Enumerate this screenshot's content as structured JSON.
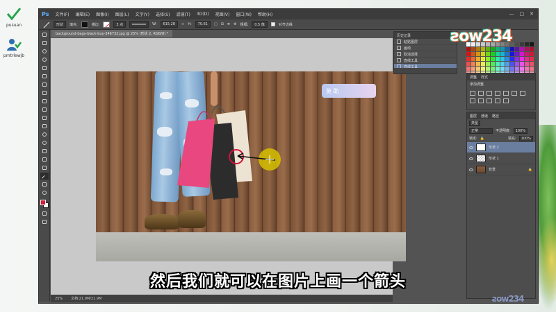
{
  "desktop": {
    "icons": [
      {
        "label": "pusuan",
        "icon": "check-icon"
      },
      {
        "label": "pmtrlewjb",
        "icon": "user-icon"
      }
    ]
  },
  "ps": {
    "logo": "Ps",
    "menu": [
      "文件(F)",
      "编辑(E)",
      "图像(I)",
      "图层(L)",
      "文字(Y)",
      "选择(S)",
      "滤镜(T)",
      "3D(D)",
      "视图(V)",
      "窗口(W)",
      "帮助(H)"
    ],
    "window_controls": [
      "—",
      "□",
      "✕"
    ],
    "options": {
      "tool_mode": "形状",
      "fill_label": "填充:",
      "stroke_label": "描边:",
      "stroke_width": "3 点",
      "w_label": "W:",
      "w_value": "615.28",
      "h_label": "H:",
      "h_value": "70.61",
      "weight_label": "粗细:",
      "weight_value": "0.5 像",
      "align_edges": "对齐边缘"
    },
    "doc_tab": "background-bags-black-buy-346732.jpg @ 25% (形状 2, RGB/8) *",
    "history": {
      "title": "历史记录",
      "rows": [
        "粘贴图层",
        "画动",
        "取消选择",
        "直线工具",
        "直线工具"
      ]
    },
    "adjustments": {
      "tab1": "调整",
      "tab2": "样式",
      "label": "添加调整"
    },
    "layers": {
      "tabs": [
        "图层",
        "通道",
        "路径"
      ],
      "kind": "类型",
      "blend": "正常",
      "opacity_label": "不透明度:",
      "opacity": "100%",
      "lock_label": "锁定:",
      "fill_label": "填充:",
      "fill": "100%",
      "rows": [
        {
          "name": "形状 2",
          "active": true
        },
        {
          "name": "形状 1",
          "active": false
        },
        {
          "name": "背景",
          "active": false
        }
      ]
    },
    "status": {
      "zoom": "25%",
      "doc": "文档:21.9M/21.9M"
    }
  },
  "photo": {
    "badge_text": "英 助"
  },
  "watermark": {
    "big": "ƨow234",
    "small": "ƨow234"
  },
  "caption": "然后我们就可以在图片上画一个箭头",
  "colors": {
    "accent_fg": "#d81b3a",
    "ps_blue": "#5fb0ff",
    "panel_bg": "#535353"
  }
}
